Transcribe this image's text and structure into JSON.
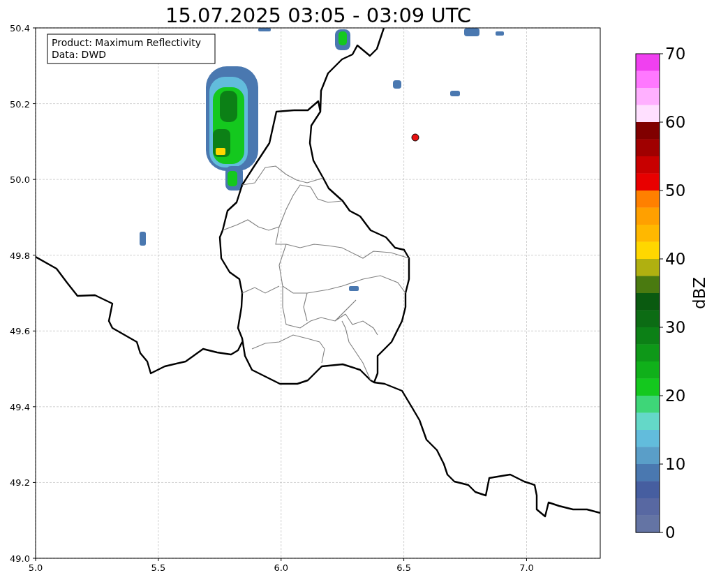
{
  "title": "15.07.2025 03:05 - 03:09 UTC",
  "map": {
    "info_box": {
      "lines": [
        "Product: Maximum Reflectivity",
        "Data: DWD"
      ]
    },
    "xticks": [
      "5.0",
      "5.5",
      "6.0",
      "6.5",
      "7.0"
    ],
    "yticks": [
      "50.4",
      "50.2",
      "50.0",
      "49.8",
      "49.6",
      "49.4",
      "49.2",
      "49.0"
    ]
  },
  "colorbar": {
    "label": "dBZ",
    "ticks": [
      "70",
      "60",
      "50",
      "40",
      "30",
      "20",
      "10",
      "0"
    ],
    "bins": [
      {
        "color": "#f040f0"
      },
      {
        "color": "#ff78ff"
      },
      {
        "color": "#ffb0ff"
      },
      {
        "color": "#ffe0ff"
      },
      {
        "color": "#800000"
      },
      {
        "color": "#a00000"
      },
      {
        "color": "#c80000"
      },
      {
        "color": "#e80000"
      },
      {
        "color": "#ff8000"
      },
      {
        "color": "#ffa000"
      },
      {
        "color": "#ffb800"
      },
      {
        "color": "#ffd700"
      },
      {
        "color": "#b0b010"
      },
      {
        "color": "#4a7a10"
      },
      {
        "color": "#0a5a10"
      },
      {
        "color": "#0c6c14"
      },
      {
        "color": "#0c8016"
      },
      {
        "color": "#0e9818"
      },
      {
        "color": "#10b01a"
      },
      {
        "color": "#14c81e"
      },
      {
        "color": "#3ed678"
      },
      {
        "color": "#64d8c8"
      },
      {
        "color": "#62bcdc"
      },
      {
        "color": "#5a9ec8"
      },
      {
        "color": "#4a78b0"
      },
      {
        "color": "#465ea0"
      },
      {
        "color": "#5868a2"
      },
      {
        "color": "#6474a4"
      }
    ]
  }
}
